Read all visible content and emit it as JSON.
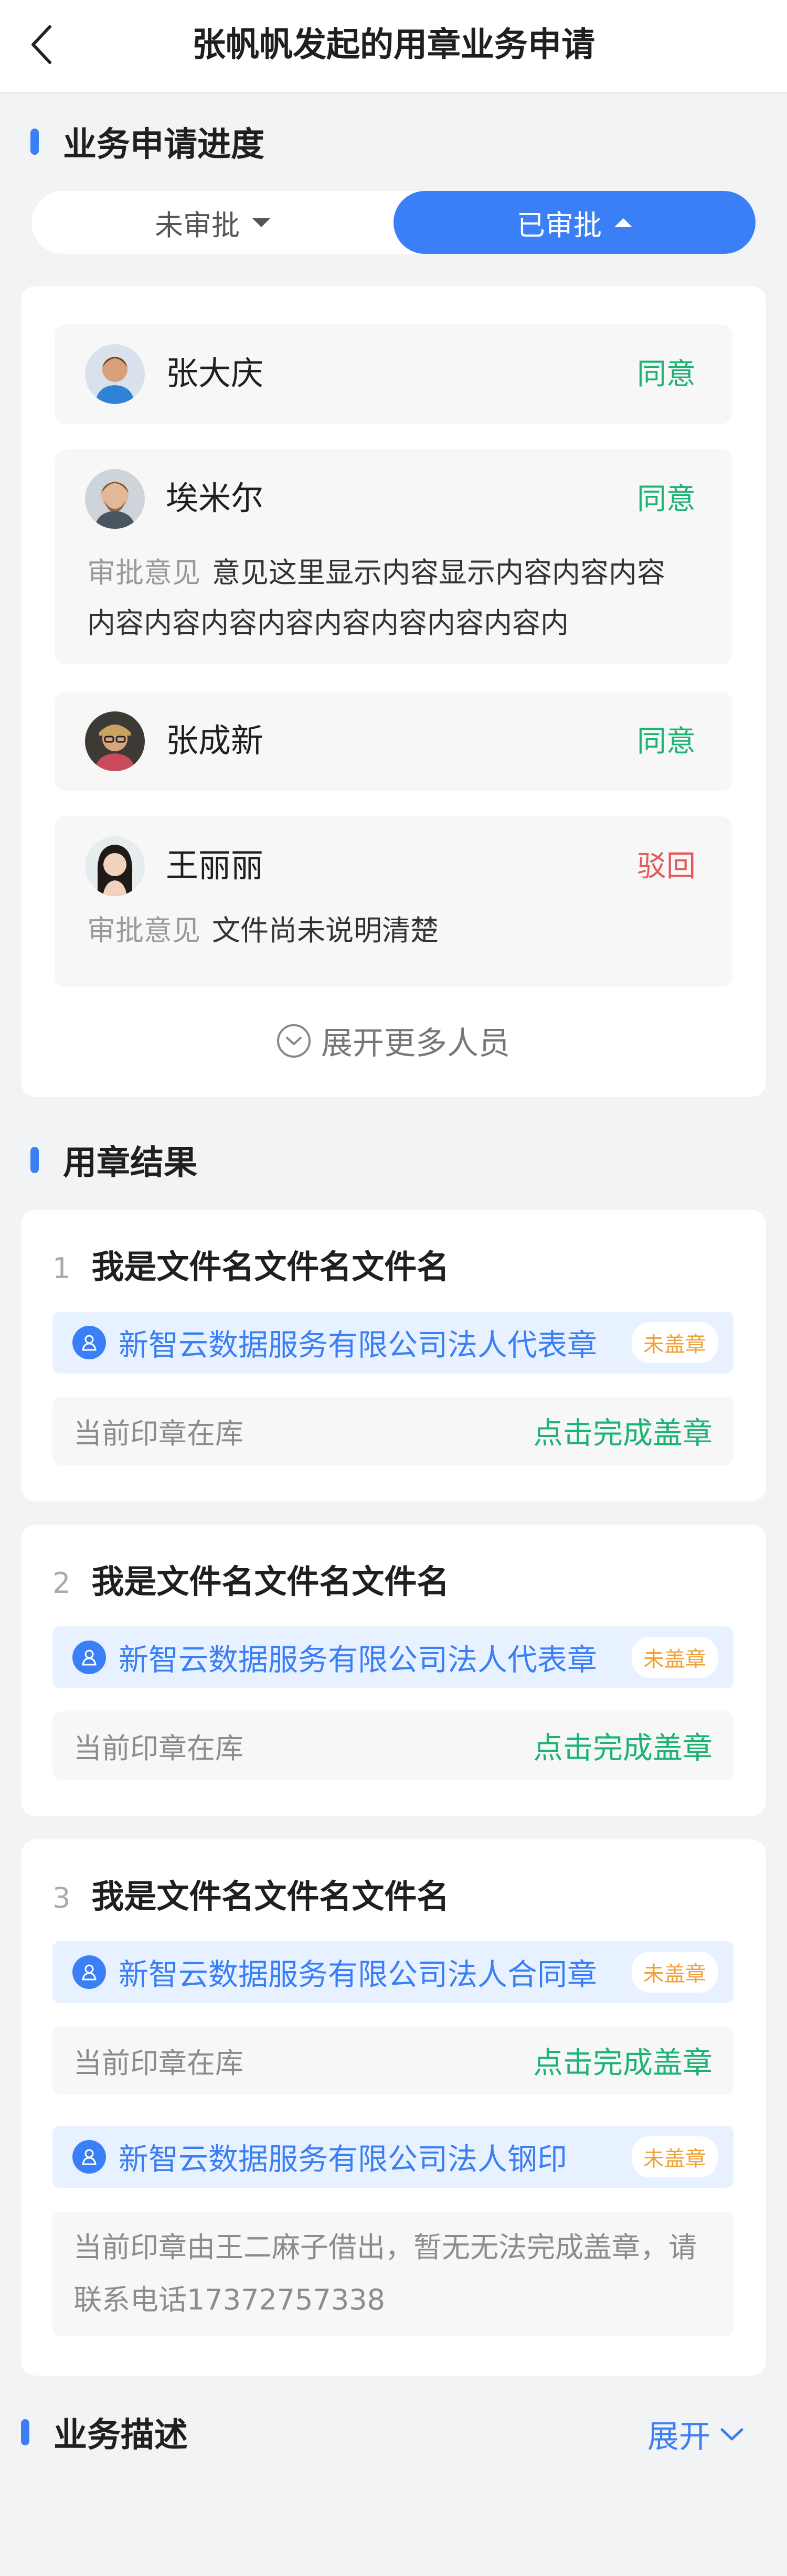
{
  "header": {
    "title": "张帆帆发起的用章业务申请"
  },
  "progress": {
    "section_title": "业务申请进度",
    "tabs": [
      {
        "label": "未审批",
        "active": false
      },
      {
        "label": "已审批",
        "active": true
      }
    ],
    "approvers": [
      {
        "name": "张大庆",
        "status": "同意"
      },
      {
        "name": "埃米尔",
        "status": "同意",
        "opinion_label": "审批意见",
        "opinion": "意见这里显示内容显示内容内容内容内容内容内容内容内容内容内容内容内"
      },
      {
        "name": "张成新",
        "status": "同意"
      },
      {
        "name": "王丽丽",
        "status": "驳回",
        "opinion_label": "审批意见",
        "opinion": "文件尚未说明清楚"
      }
    ],
    "expand_more": "展开更多人员"
  },
  "result": {
    "section_title": "用章结果",
    "files": [
      {
        "num": "1",
        "name": "我是文件名文件名文件名",
        "seals": [
          {
            "name": "新智云数据服务有限公司法人代表章",
            "badge": "未盖章",
            "stock": "当前印章在库",
            "action": "点击完成盖章"
          }
        ]
      },
      {
        "num": "2",
        "name": "我是文件名文件名文件名",
        "seals": [
          {
            "name": "新智云数据服务有限公司法人代表章",
            "badge": "未盖章",
            "stock": "当前印章在库",
            "action": "点击完成盖章"
          }
        ]
      },
      {
        "num": "3",
        "name": "我是文件名文件名文件名",
        "seals": [
          {
            "name": "新智云数据服务有限公司法人合同章",
            "badge": "未盖章",
            "stock": "当前印章在库",
            "action": "点击完成盖章"
          },
          {
            "name": "新智云数据服务有限公司法人钢印",
            "badge": "未盖章",
            "note": "当前印章由王二麻子借出，暂无无法完成盖章，请联系电话17372757338"
          }
        ]
      }
    ]
  },
  "description": {
    "section_title": "业务描述",
    "expand_label": "展开"
  },
  "colors": {
    "accent": "#3a7ff5",
    "approve": "#1db374",
    "reject": "#e45a5a",
    "badge": "#f1a13a"
  }
}
